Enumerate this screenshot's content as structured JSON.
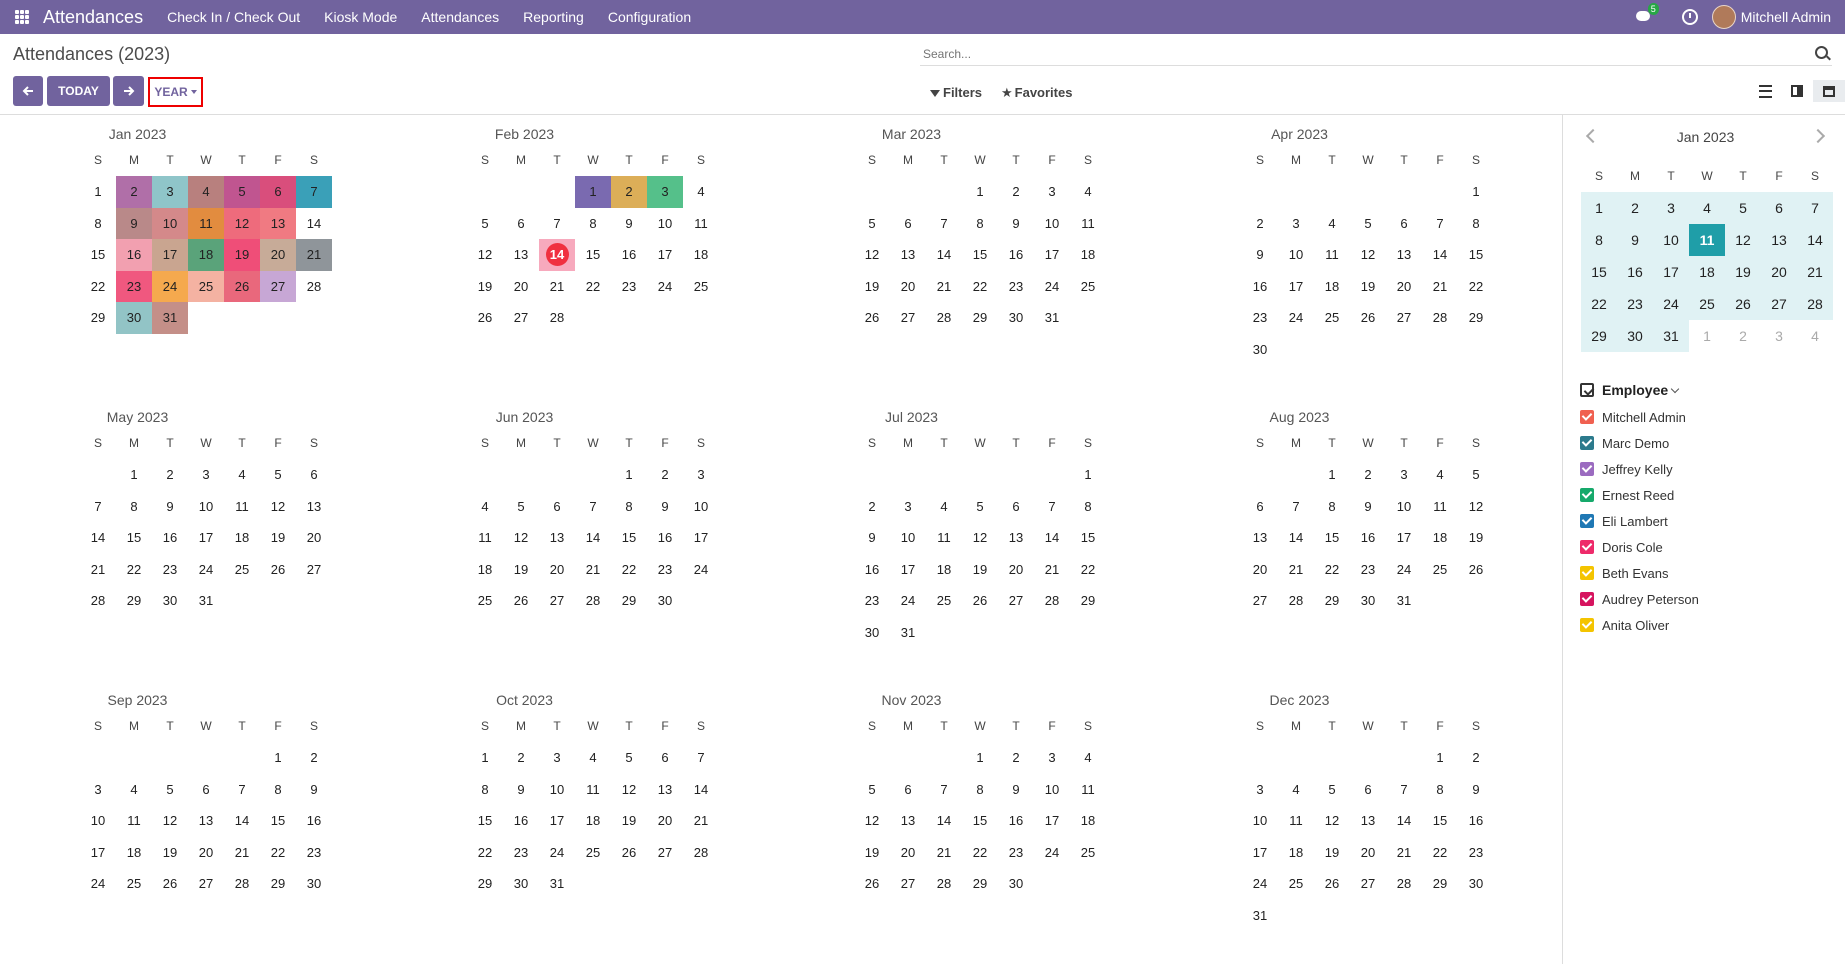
{
  "navbar": {
    "brand": "Attendances",
    "menu": [
      "Check In / Check Out",
      "Kiosk Mode",
      "Attendances",
      "Reporting",
      "Configuration"
    ],
    "chat_badge": "5",
    "user": "Mitchell Admin"
  },
  "control": {
    "breadcrumb": "Attendances (2023)",
    "search_placeholder": "Search...",
    "today_label": "TODAY",
    "scale_label": "YEAR",
    "filters_label": "Filters",
    "favorites_label": "Favorites"
  },
  "weekday_headers": [
    "S",
    "M",
    "T",
    "W",
    "T",
    "F",
    "S"
  ],
  "year": {
    "months": [
      {
        "title": "Jan 2023",
        "first_weekday": 0,
        "days": 31,
        "colors": {
          "2": "#b06fa8",
          "3": "#8fc5c9",
          "4": "#b8807e",
          "5": "#c05590",
          "6": "#d94e7c",
          "7": "#3aa0b8",
          "9": "#b98989",
          "10": "#d4898a",
          "11": "#e28c3f",
          "12": "#ee6b7c",
          "13": "#f07a82",
          "16": "#f2a0b0",
          "17": "#c9a590",
          "18": "#5aa37a",
          "19": "#ef4e78",
          "20": "#c7ab98",
          "21": "#8f959a",
          "23": "#f0587f",
          "24": "#f5a94e",
          "25": "#f4b2a2",
          "26": "#e9687c",
          "27": "#c7a7d5",
          "30": "#92c4c6",
          "31": "#c48f88"
        }
      },
      {
        "title": "Feb 2023",
        "first_weekday": 3,
        "days": 28,
        "colors": {
          "1": "#7a6ab0",
          "2": "#dcae58",
          "3": "#55c08a"
        },
        "today": 14
      },
      {
        "title": "Mar 2023",
        "first_weekday": 3,
        "days": 31
      },
      {
        "title": "Apr 2023",
        "first_weekday": 6,
        "days": 30
      },
      {
        "title": "May 2023",
        "first_weekday": 1,
        "days": 31
      },
      {
        "title": "Jun 2023",
        "first_weekday": 4,
        "days": 30
      },
      {
        "title": "Jul 2023",
        "first_weekday": 6,
        "days": 31
      },
      {
        "title": "Aug 2023",
        "first_weekday": 2,
        "days": 31
      },
      {
        "title": "Sep 2023",
        "first_weekday": 5,
        "days": 30
      },
      {
        "title": "Oct 2023",
        "first_weekday": 0,
        "days": 31
      },
      {
        "title": "Nov 2023",
        "first_weekday": 3,
        "days": 30
      },
      {
        "title": "Dec 2023",
        "first_weekday": 5,
        "days": 31
      }
    ]
  },
  "mini_calendar": {
    "title": "Jan 2023",
    "rows": [
      [
        "1",
        "2",
        "3",
        "4",
        "5",
        "6",
        "7"
      ],
      [
        "8",
        "9",
        "10",
        "11",
        "12",
        "13",
        "14"
      ],
      [
        "15",
        "16",
        "17",
        "18",
        "19",
        "20",
        "21"
      ],
      [
        "22",
        "23",
        "24",
        "25",
        "26",
        "27",
        "28"
      ],
      [
        "29",
        "30",
        "31",
        "1",
        "2",
        "3",
        "4"
      ]
    ],
    "selected": "11",
    "other_month_start_index": 31
  },
  "employee_filter": {
    "title": "Employee",
    "items": [
      {
        "name": "Mitchell Admin",
        "color": "#f06050"
      },
      {
        "name": "Marc Demo",
        "color": "#2c7a8c"
      },
      {
        "name": "Jeffrey Kelly",
        "color": "#9b6bc0"
      },
      {
        "name": "Ernest Reed",
        "color": "#16a96b"
      },
      {
        "name": "Eli Lambert",
        "color": "#1f78b4"
      },
      {
        "name": "Doris Cole",
        "color": "#ee2a6a"
      },
      {
        "name": "Beth Evans",
        "color": "#f4c400"
      },
      {
        "name": "Audrey Peterson",
        "color": "#d6145f"
      },
      {
        "name": "Anita Oliver",
        "color": "#f4c400"
      }
    ]
  }
}
